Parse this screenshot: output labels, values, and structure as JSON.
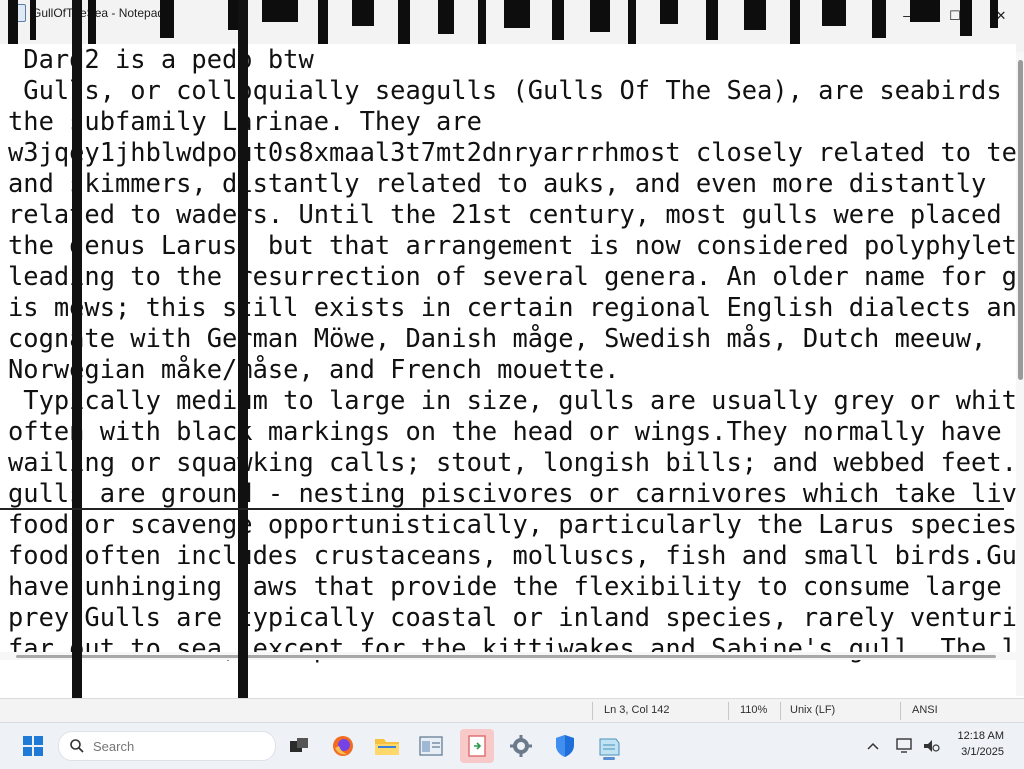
{
  "window": {
    "title": "GullOfTheSea - Notepad",
    "minimize_glyph": "—",
    "maximize_glyph": "☐",
    "close_glyph": "✕"
  },
  "editor": {
    "lines": [
      " Dard2 is a pedo btw",
      "",
      " Gulls, or colloquially seagulls (Gulls Of The Sea), are seabirds of",
      "the subfamily Larinae. They are",
      "w3jqey1jhblwdpout0s8xmaal3t7mt2dnryarrrhmost closely related to terns",
      "and skimmers, distantly related to auks, and even more distantly",
      "related to waders. Until the 21st century, most gulls were placed in",
      "the genus Larus, but that arrangement is now considered polyphyletic,",
      "leading to the resurrection of several genera. An older name for gulls",
      "is mews; this still exists in certain regional English dialects and is",
      "cognate with German Möwe, Danish måge, Swedish mås, Dutch meeuw,",
      "Norwegian måke/måse, and French mouette.",
      " Typically medium to large in size, gulls are usually grey or white,",
      "often with black markings on the head or wings.They normally have harsh",
      "wailing or squawking calls; stout, longish bills; and webbed feet.Most",
      "gulls are ground - nesting piscivores or carnivores which take live",
      "food or scavenge opportunistically, particularly the Larus species.Live",
      "food often includes crustaceans, molluscs, fish and small birds.Gulls",
      "have unhinging jaws that provide the flexibility to consume large",
      "prey.Gulls are typically coastal or inland species, rarely venturing",
      "far out to sea, except for the kittiwakes and Sabine's gull. The large"
    ]
  },
  "statusbar": {
    "position": "Ln 3, Col 142",
    "zoom": "110%",
    "line_ending": "Unix (LF)",
    "encoding": "ANSI"
  },
  "taskbar": {
    "search_placeholder": "Search",
    "time": "12:18 AM",
    "date": "3/1/2025",
    "icons": [
      "windows-start-icon",
      "task-view-icon",
      "firefox-icon",
      "file-explorer-icon",
      "notepad-doc-icon",
      "red-app-icon",
      "settings-icon",
      "windows-security-icon",
      "notepad-icon"
    ]
  },
  "colors": {
    "windows_blue": "#1f7ad6",
    "firefox_orange": "#f26b21",
    "folder_yellow": "#f7c23e",
    "security_blue": "#1e6fd9",
    "app_red": "#e06a6a"
  }
}
